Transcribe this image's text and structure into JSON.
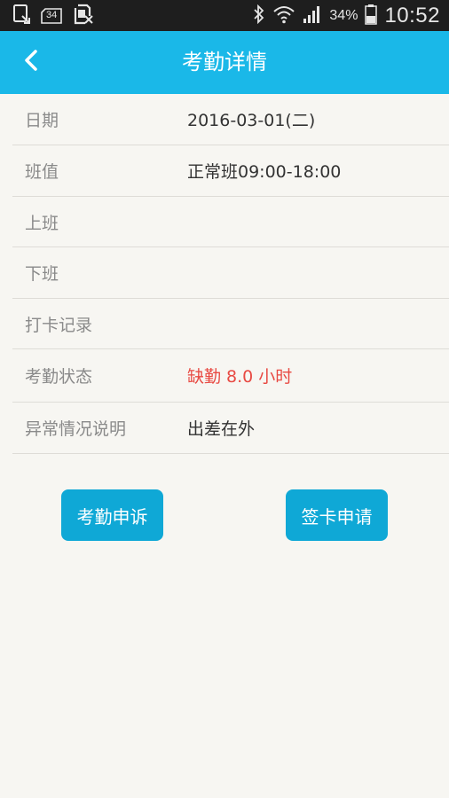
{
  "status_bar": {
    "sim_badge": "34",
    "battery_percent": "34%",
    "time": "10:52",
    "icons": [
      "screenshot-icon",
      "sim-card-icon",
      "no-sim-icon",
      "bluetooth-icon",
      "wifi-icon",
      "signal-icon",
      "battery-icon"
    ]
  },
  "header": {
    "title": "考勤详情",
    "back_icon": "chevron-left-icon"
  },
  "details": [
    {
      "label": "日期",
      "value": "2016-03-01(二)"
    },
    {
      "label": "班值",
      "value": "正常班09:00-18:00"
    },
    {
      "label": "上班",
      "value": ""
    },
    {
      "label": "下班",
      "value": ""
    },
    {
      "label": "打卡记录",
      "value": ""
    },
    {
      "label": "考勤状态",
      "value": "缺勤 8.0 小时"
    },
    {
      "label": "异常情况说明",
      "value": "出差在外"
    }
  ],
  "actions": {
    "appeal_label": "考勤申诉",
    "sign_label": "签卡申请"
  },
  "colors": {
    "header_bg": "#1ab8e8",
    "button_bg": "#0fa8d6",
    "alert_text": "#e84a43",
    "page_bg": "#f7f6f2"
  }
}
